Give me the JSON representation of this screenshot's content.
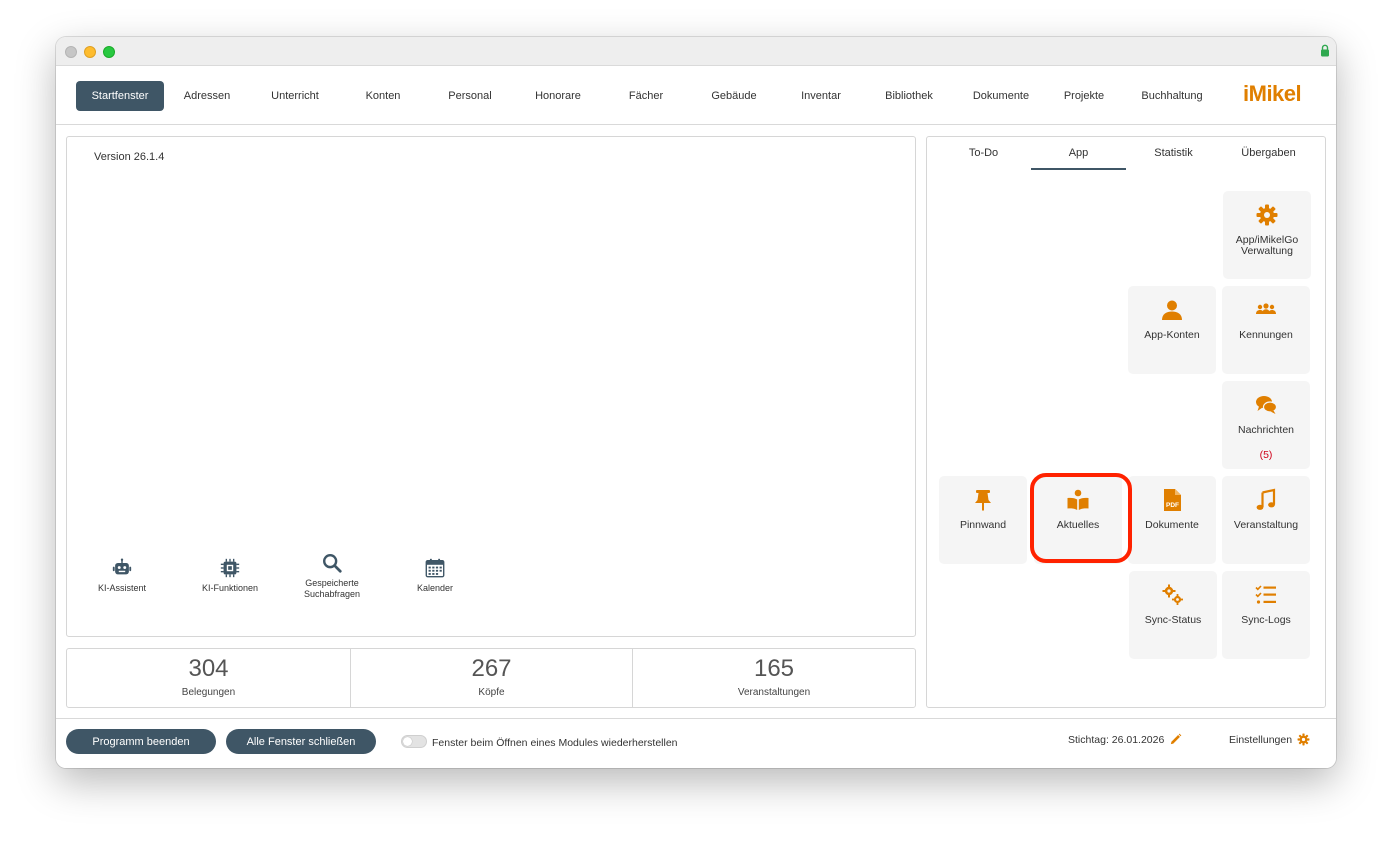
{
  "nav": {
    "items": [
      {
        "label": "Startfenster",
        "active": true
      },
      {
        "label": "Adressen"
      },
      {
        "label": "Unterricht"
      },
      {
        "label": "Konten"
      },
      {
        "label": "Personal"
      },
      {
        "label": "Honorare"
      },
      {
        "label": "Fächer"
      },
      {
        "label": "Gebäude"
      },
      {
        "label": "Inventar"
      },
      {
        "label": "Bibliothek"
      },
      {
        "label": "Dokumente"
      },
      {
        "label": "Projekte"
      },
      {
        "label": "Buchhaltung"
      }
    ],
    "logo": "iMikel"
  },
  "main": {
    "version": "Version 26.1.4",
    "tools": [
      {
        "label": "KI-Assistent",
        "icon": "robot-icon"
      },
      {
        "label": "KI-Funktionen",
        "icon": "chip-icon"
      },
      {
        "label": "Gespeicherte Suchabfragen",
        "icon": "search-icon"
      },
      {
        "label": "Kalender",
        "icon": "calendar-icon"
      }
    ],
    "stats": [
      {
        "value": "304",
        "label": "Belegungen"
      },
      {
        "value": "267",
        "label": "Köpfe"
      },
      {
        "value": "165",
        "label": "Veranstaltungen"
      }
    ]
  },
  "side": {
    "tabs": [
      {
        "label": "To-Do"
      },
      {
        "label": "App",
        "active": true
      },
      {
        "label": "Statistik"
      },
      {
        "label": "Übergaben"
      }
    ],
    "tiles": {
      "app_verwaltung": "App/iMikelGo Verwaltung",
      "app_konten": "App-Konten",
      "kennungen": "Kennungen",
      "nachrichten": "Nachrichten",
      "nachrichten_badge": "(5)",
      "pinnwand": "Pinnwand",
      "aktuelles": "Aktuelles",
      "dokumente": "Dokumente",
      "veranstaltung": "Veranstaltung",
      "sync_status": "Sync-Status",
      "sync_logs": "Sync-Logs"
    }
  },
  "footer": {
    "quit": "Programm beenden",
    "close_all": "Alle Fenster schließen",
    "restore_label": "Fenster beim Öffnen eines Modules wiederherstellen",
    "stichtag": "Stichtag: 26.01.2026",
    "settings": "Einstellungen"
  },
  "colors": {
    "accent": "#e07f00",
    "nav_active": "#3f5666",
    "badge": "#d0021b",
    "highlight": "#ff2200"
  }
}
